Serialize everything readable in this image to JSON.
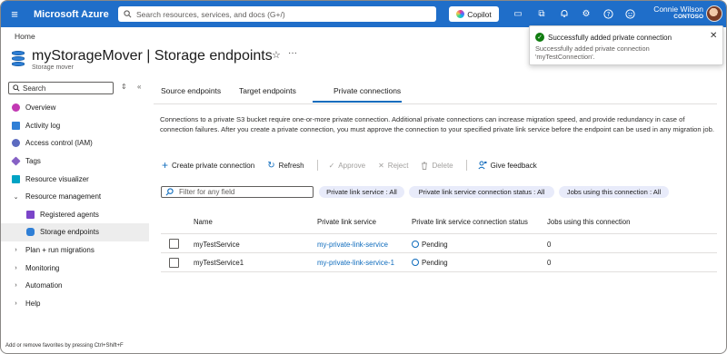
{
  "topbar": {
    "brand": "Microsoft Azure",
    "search_placeholder": "Search resources, services, and docs (G+/)",
    "copilot_label": "Copilot",
    "user_name": "Connie Wilson",
    "user_org": "CONTOSO"
  },
  "breadcrumb": "Home",
  "header": {
    "title": "myStorageMover | Storage endpoints",
    "subtitle": "Storage mover"
  },
  "sidebar": {
    "search_placeholder": "Search",
    "items": [
      {
        "label": "Overview",
        "icon": "overview-icon"
      },
      {
        "label": "Activity log",
        "icon": "activity-log-icon"
      },
      {
        "label": "Access control (IAM)",
        "icon": "iam-icon"
      },
      {
        "label": "Tags",
        "icon": "tag-icon"
      },
      {
        "label": "Resource visualizer",
        "icon": "visualizer-icon"
      },
      {
        "label": "Resource management",
        "expanded": true
      },
      {
        "label": "Registered agents",
        "icon": "agent-icon",
        "sub": true
      },
      {
        "label": "Storage endpoints",
        "icon": "storage-icon",
        "sub": true,
        "active": true
      },
      {
        "label": "Plan + run migrations",
        "expanded": false
      },
      {
        "label": "Monitoring",
        "expanded": false
      },
      {
        "label": "Automation",
        "expanded": false
      },
      {
        "label": "Help",
        "expanded": false
      }
    ],
    "footer": "Add or remove favorites by pressing Ctrl+Shift+F"
  },
  "tabs": [
    "Source endpoints",
    "Target endpoints",
    "Private connections"
  ],
  "active_tab": "Private connections",
  "description": "Connections to a private S3 bucket require one-or-more private connection. Additional private connections can increase migration speed, and provide redundancy in case of connection failures. After you create a private connection, you must approve the connection to your specified private link service before the endpoint can be used in any migration job.",
  "toolbar": {
    "create": "Create private connection",
    "refresh": "Refresh",
    "approve": "Approve",
    "reject": "Reject",
    "delete": "Delete",
    "feedback": "Give feedback"
  },
  "filter": {
    "placeholder": "Filter for any field",
    "pills": [
      "Private link service : All",
      "Private link service connection status : All",
      "Jobs using this connection : All"
    ]
  },
  "table": {
    "columns": [
      "Name",
      "Private link service",
      "Private link service connection status",
      "Jobs using this connection"
    ],
    "rows": [
      {
        "name": "myTestService",
        "service": "my-private-link-service",
        "status": "Pending",
        "jobs": "0"
      },
      {
        "name": "myTestService1",
        "service": "my-private-link-service-1",
        "status": "Pending",
        "jobs": "0"
      }
    ]
  },
  "toast": {
    "title": "Successfully added private connection",
    "body": "Successfully added private connection 'myTestConnection'."
  },
  "colors": {
    "topbar": "#1f6ec9",
    "accent": "#0f6cbd",
    "success": "#107c10"
  }
}
